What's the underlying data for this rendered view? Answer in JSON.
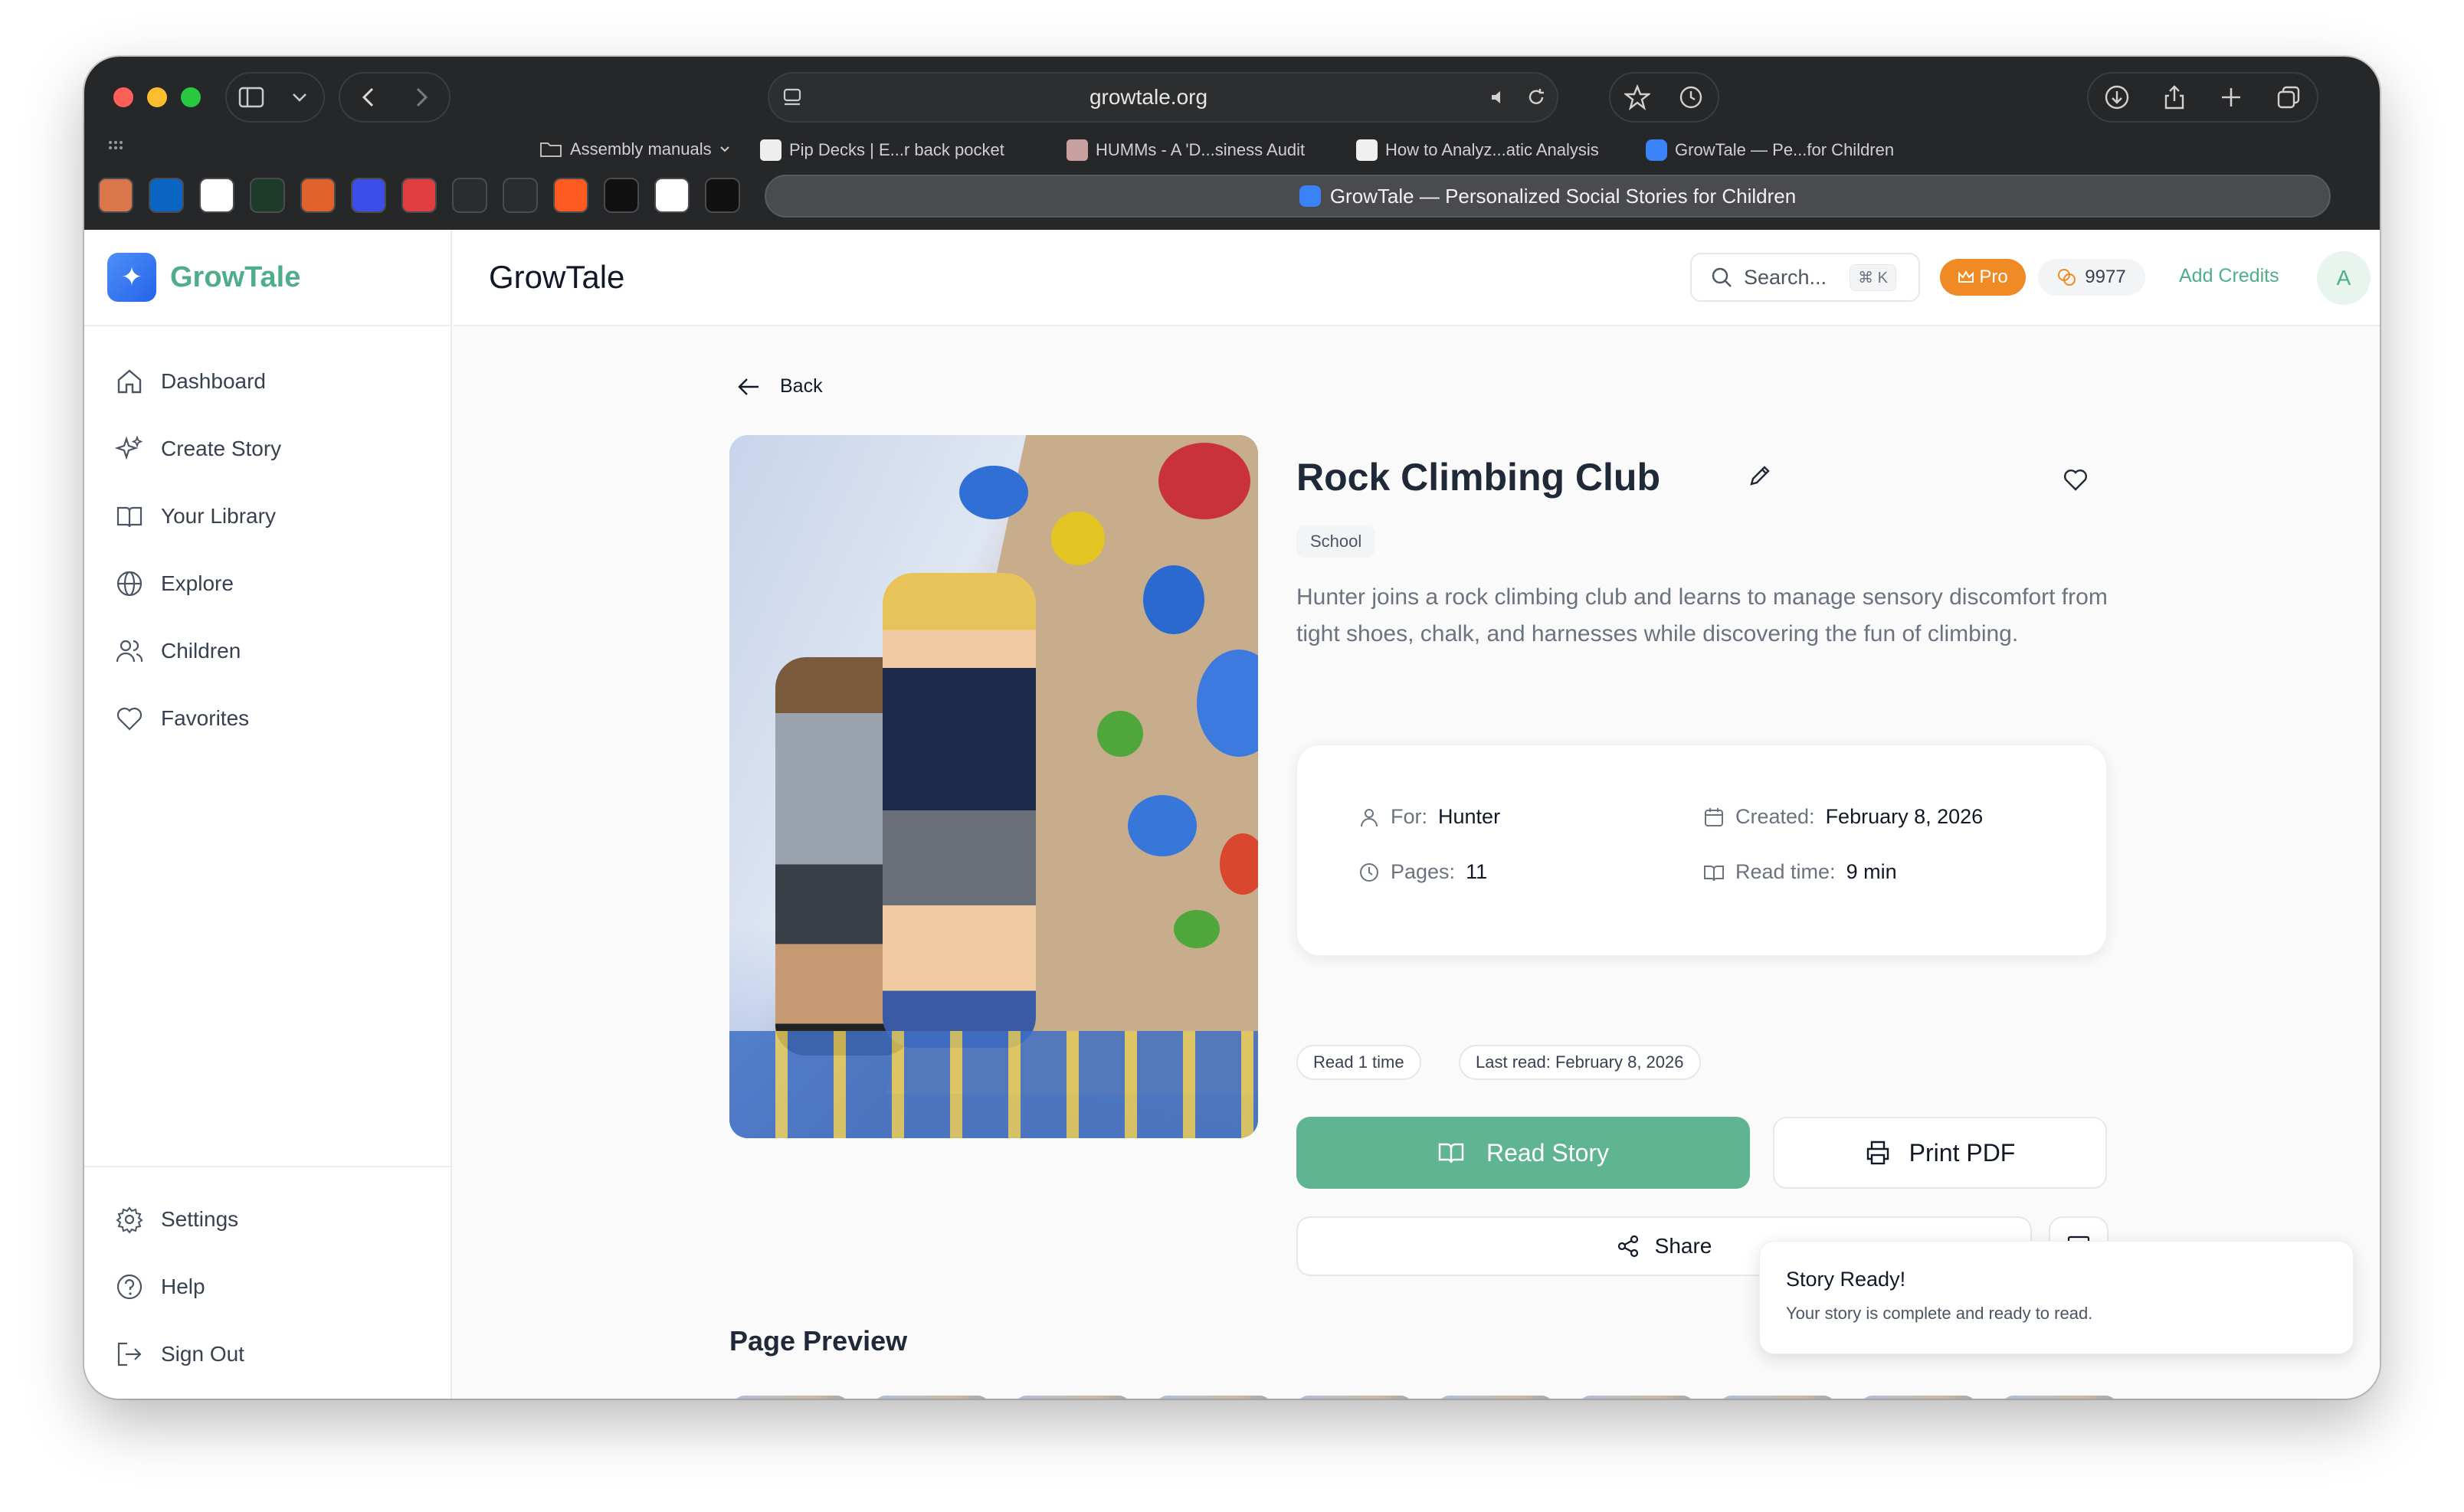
{
  "browser": {
    "url": "growtale.org",
    "bookmarks": [
      "Assembly manuals",
      "Pip Decks | E...r back pocket",
      "HUMMs - A 'D...siness Audit",
      "How to Analyz...atic Analysis",
      "GrowTale — Pe...for Children"
    ],
    "active_tab_title": "GrowTale — Personalized Social Stories for Children"
  },
  "sidebar": {
    "brand": "GrowTale",
    "nav": [
      {
        "label": "Dashboard",
        "icon": "home-icon"
      },
      {
        "label": "Create Story",
        "icon": "sparkles-icon"
      },
      {
        "label": "Your Library",
        "icon": "book-open-icon"
      },
      {
        "label": "Explore",
        "icon": "globe-icon"
      },
      {
        "label": "Children",
        "icon": "users-icon"
      },
      {
        "label": "Favorites",
        "icon": "heart-icon"
      }
    ],
    "bottom": [
      {
        "label": "Settings",
        "icon": "gear-icon"
      },
      {
        "label": "Help",
        "icon": "help-circle-icon"
      },
      {
        "label": "Sign Out",
        "icon": "sign-out-icon"
      }
    ]
  },
  "header": {
    "title": "GrowTale",
    "search_placeholder": "Search...",
    "search_shortcut": "⌘ K",
    "pro_label": "Pro",
    "credits": "9977",
    "add_credits": "Add Credits",
    "avatar_initial": "A"
  },
  "story": {
    "back_label": "Back",
    "title": "Rock Climbing Club",
    "tag": "School",
    "description": "Hunter joins a rock climbing club and learns to manage sensory discomfort from tight shoes, chalk, and harnesses while discovering the fun of climbing.",
    "for_label": "For:",
    "for_value": "Hunter",
    "created_label": "Created:",
    "created_value": "February 8, 2026",
    "pages_label": "Pages:",
    "pages_value": "11",
    "readtime_label": "Read time:",
    "readtime_value": "9 min",
    "read_count": "Read 1 time",
    "last_read": "Last read: February 8, 2026",
    "read_button": "Read Story",
    "print_button": "Print PDF",
    "share_button": "Share"
  },
  "preview": {
    "title": "Page Preview",
    "thumb_count": 10
  },
  "toast": {
    "title": "Story Ready!",
    "message": "Your story is complete and ready to read."
  },
  "colors": {
    "brand_green": "#4fae8a",
    "read_button": "#5fb592",
    "pro_orange": "#f08a24",
    "chrome_dark": "#262729"
  }
}
